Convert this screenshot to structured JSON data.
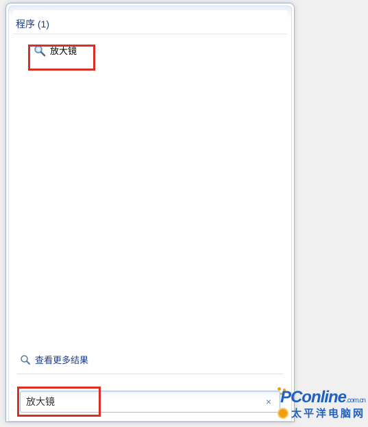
{
  "section": {
    "header": "程序 (1)"
  },
  "results": {
    "items": [
      {
        "label": "放大镜",
        "icon": "magnifier-icon"
      }
    ]
  },
  "more_results": {
    "label": "查看更多结果"
  },
  "search": {
    "value": "放大镜",
    "clear_symbol": "×"
  },
  "watermark": {
    "brand": "PConline",
    "suffix": ".com.cn",
    "subtitle": "太平洋电脑网"
  }
}
